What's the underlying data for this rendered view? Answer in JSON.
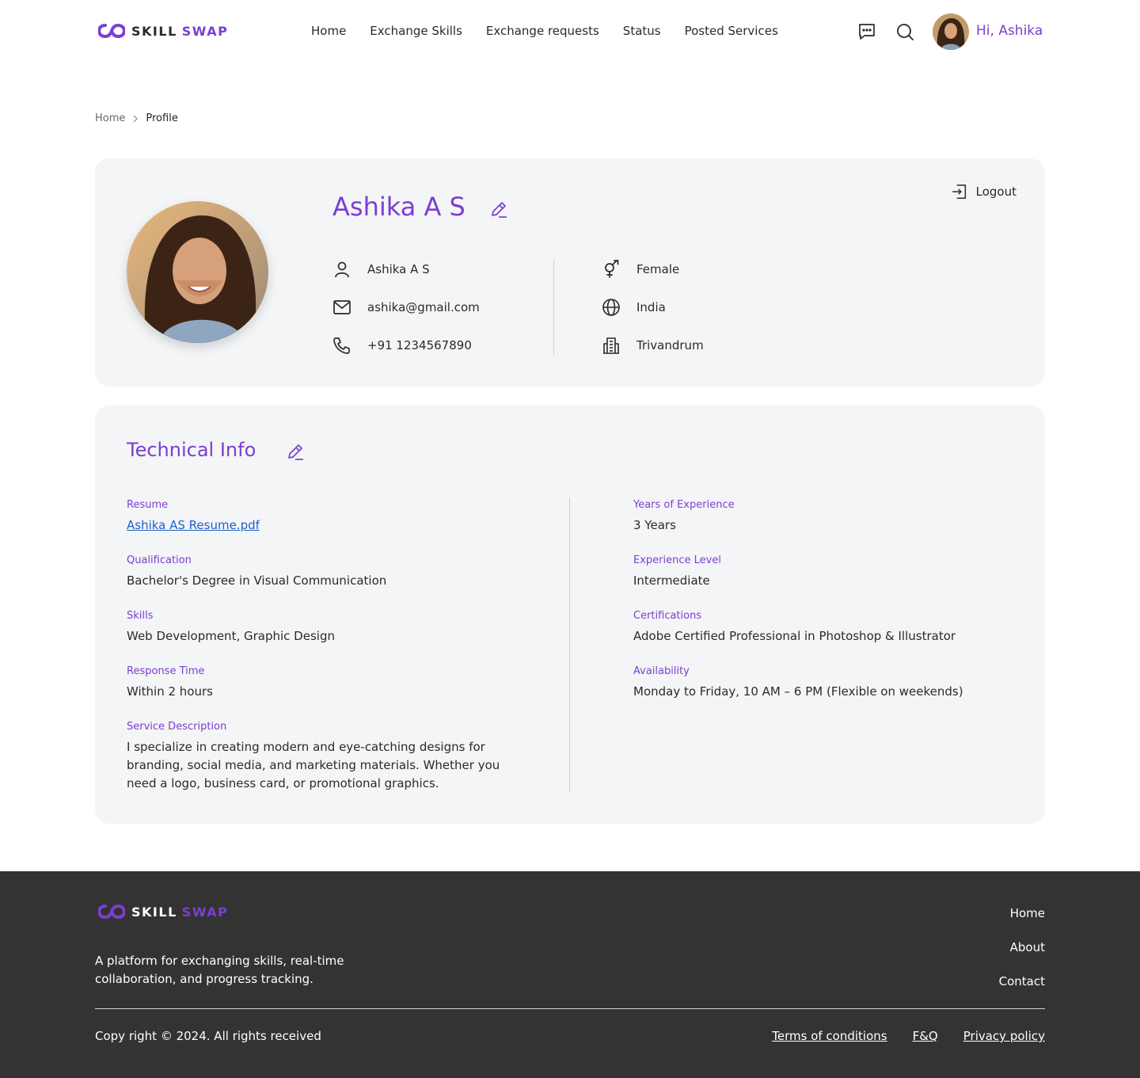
{
  "brand": {
    "skill": "SKILL",
    "swap": "SWAP"
  },
  "nav": {
    "home": "Home",
    "exchange_skills": "Exchange Skills",
    "exchange_requests": "Exchange requests",
    "status": "Status",
    "posted_services": "Posted Services"
  },
  "header": {
    "greeting": "Hi, Ashika"
  },
  "breadcrumb": {
    "home": "Home",
    "current": "Profile"
  },
  "profile": {
    "name": "Ashika A S",
    "logout": "Logout",
    "full_name": "Ashika A S",
    "email": "ashika@gmail.com",
    "phone": "+91 1234567890",
    "gender": "Female",
    "country": "India",
    "city": "Trivandrum"
  },
  "technical": {
    "title": "Technical Info",
    "resume": {
      "label": "Resume",
      "value": "Ashika AS Resume.pdf"
    },
    "qualification": {
      "label": "Qualification",
      "value": "Bachelor's Degree in Visual Communication"
    },
    "skills": {
      "label": "Skills",
      "value": "Web Development, Graphic Design"
    },
    "response_time": {
      "label": "Response Time",
      "value": "Within 2 hours"
    },
    "service_description": {
      "label": "Service Description",
      "value": "I specialize in creating modern and eye-catching designs for branding, social media, and marketing materials. Whether you need a logo, business card, or promotional graphics."
    },
    "years_experience": {
      "label": "Years of Experience",
      "value": "3 Years"
    },
    "experience_level": {
      "label": "Experience Level",
      "value": "Intermediate"
    },
    "certifications": {
      "label": "Certifications",
      "value": "Adobe Certified Professional in Photoshop & Illustrator"
    },
    "availability": {
      "label": "Availability",
      "value": "Monday to Friday, 10 AM – 6 PM (Flexible on weekends)"
    }
  },
  "footer": {
    "tagline": "A platform for exchanging skills, real-time collaboration, and progress tracking.",
    "links": {
      "home": "Home",
      "about": "About",
      "contact": "Contact"
    },
    "copyright": "Copy right © 2024. All rights received",
    "legal": {
      "terms": "Terms of conditions",
      "faq": "F&Q",
      "privacy": "Privacy policy"
    }
  },
  "colors": {
    "accent": "#7b3fd0",
    "card_bg": "#f4f5f7",
    "footer_bg": "#333333",
    "link": "#1f5fc9"
  },
  "icons": [
    "logo-infinity-icon",
    "chat-icon",
    "search-icon",
    "edit-icon",
    "logout-icon",
    "user-icon",
    "mail-icon",
    "phone-icon",
    "gender-icon",
    "globe-icon",
    "building-icon",
    "chevron-right-icon"
  ]
}
